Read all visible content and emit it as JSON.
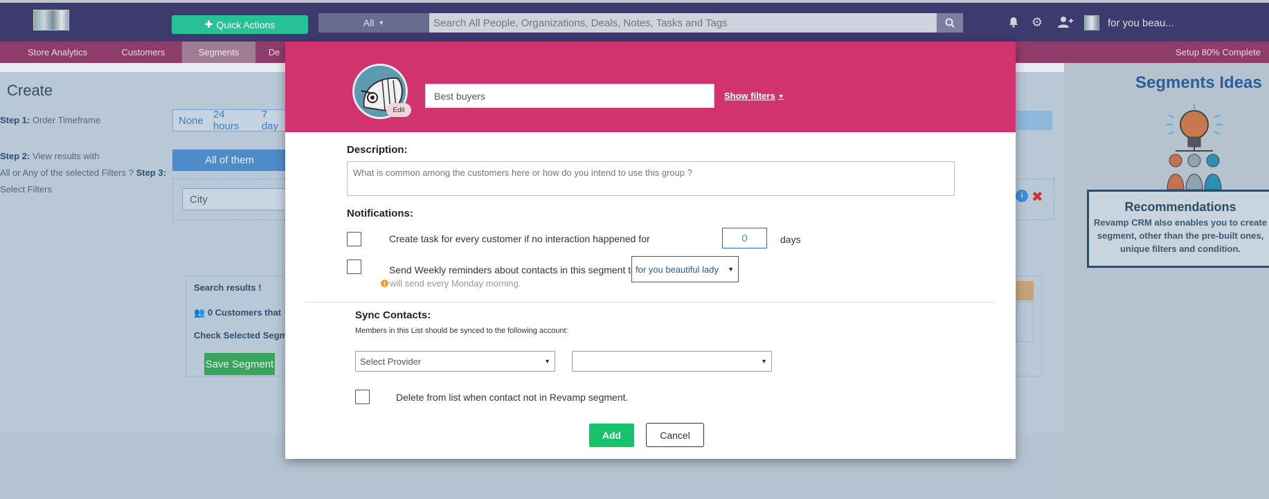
{
  "topbar": {
    "quick_actions_label": "Quick Actions",
    "search_scope": "All",
    "search_placeholder": "Search All People, Organizations, Deals, Notes, Tasks and Tags",
    "user_name": "for you beau..."
  },
  "nav": {
    "items": [
      "Store Analytics",
      "Customers",
      "Segments",
      "De"
    ],
    "active": "Segments",
    "setup_status": "Setup 80% Complete"
  },
  "background": {
    "page_title": "Create",
    "step1_label": "Step 1:",
    "step1_text": "Order Timeframe",
    "timeframes": [
      "None",
      "24 hours",
      "7 day"
    ],
    "step2_label": "Step 2:",
    "step2_text_a": "View results with",
    "step2_text_b": "All or Any of the selected Filters ?",
    "step3_label": "Step 3:",
    "step3_text": "Select Filters",
    "all_of_them": "All of them",
    "city_filter": "City",
    "search_results": "Search results !",
    "customers_count": "0 Customers that",
    "check_selected": "Check Selected Segm",
    "save_segment": "Save Segment",
    "ideas_title": "Segments Ideas",
    "reco_title": "Recommendations",
    "reco_text": "Revamp CRM also enables you to create segment, other than the pre-built ones, unique filters and condition."
  },
  "modal": {
    "segment_name": "Best buyers",
    "edit_label": "Edit",
    "show_filters": "Show filters",
    "description_label": "Description:",
    "description_placeholder": "What is common among the customers here or how do you intend to use this group ?",
    "notifications_label": "Notifications:",
    "task_text": "Create task for every customer if no interaction happened for",
    "days_value": "0",
    "days_unit": "days",
    "weekly_text": "Send Weekly reminders about contacts in this segment to",
    "weekly_recipient": "for you beautiful lady",
    "weekly_hint": "will send every Monday morning.",
    "sync_label": "Sync Contacts:",
    "sync_sub": "Members in this List should be synced to the following account:",
    "provider_placeholder": "Select Provider",
    "account_placeholder": "",
    "delete_text": "Delete from list when contact not in Revamp segment.",
    "add_label": "Add",
    "cancel_label": "Cancel"
  },
  "colors": {
    "topbar": "#3d3a6e",
    "nav": "#8e3d6a",
    "modal_header": "#d0336d",
    "quick_actions": "#27c196",
    "add_button": "#17c46b"
  }
}
